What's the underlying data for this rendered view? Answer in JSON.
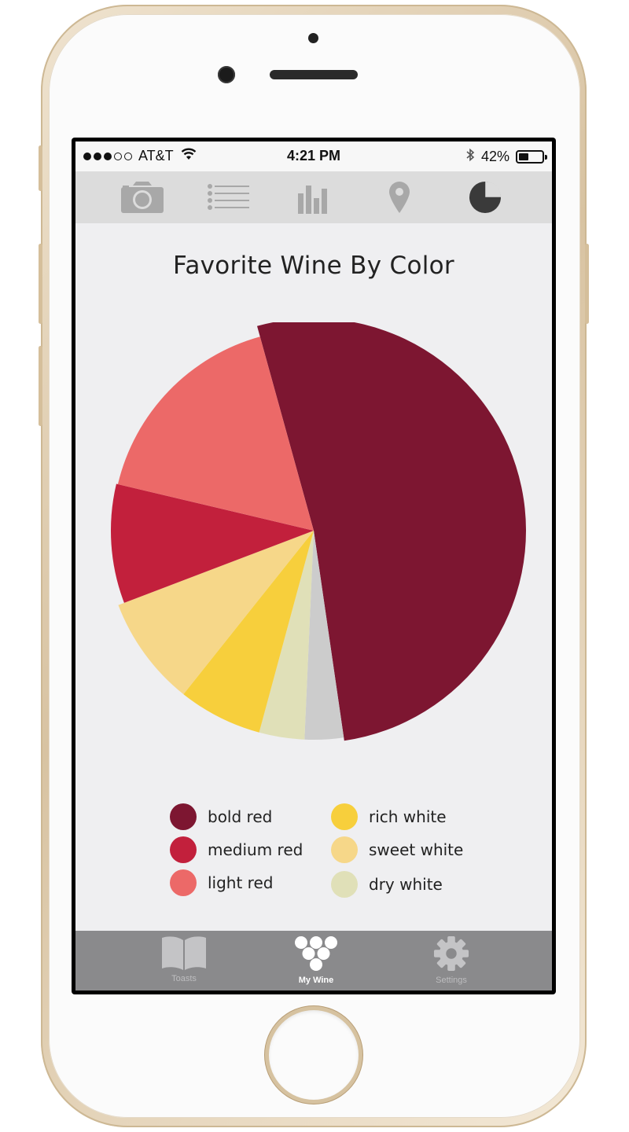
{
  "status_bar": {
    "carrier": "AT&T",
    "time": "4:21 PM",
    "battery": "42%",
    "battery_level": 0.42
  },
  "top_nav": {
    "icons": [
      "camera-icon",
      "list-icon",
      "bar-chart-icon",
      "location-pin-icon",
      "pie-chart-icon"
    ],
    "active": "pie-chart-icon"
  },
  "chart_title": "Favorite Wine By Color",
  "chart_data": {
    "type": "pie",
    "title": "Favorite Wine By Color",
    "slices": [
      {
        "label": "bold red",
        "value": 52,
        "color": "#7d1631"
      },
      {
        "label": "",
        "value": 3,
        "color": "#cccccc"
      },
      {
        "label": "dry white",
        "value": 3.5,
        "color": "#e0e0b8"
      },
      {
        "label": "rich white",
        "value": 6.5,
        "color": "#f7cf3c"
      },
      {
        "label": "sweet white",
        "value": 8.5,
        "color": "#f6d789"
      },
      {
        "label": "medium red",
        "value": 9.5,
        "color": "#c2203c"
      },
      {
        "label": "light red",
        "value": 17,
        "color": "#ec6968"
      }
    ],
    "legend_placement": "bottom"
  },
  "legend": [
    {
      "label": "bold red",
      "color": "#7d1631"
    },
    {
      "label": "medium red",
      "color": "#c2203c"
    },
    {
      "label": "light red",
      "color": "#ec6968"
    },
    {
      "label": "rich white",
      "color": "#f7cf3c"
    },
    {
      "label": "sweet white",
      "color": "#f6d789"
    },
    {
      "label": "dry white",
      "color": "#e0e0b8"
    }
  ],
  "tab_bar": {
    "tabs": [
      {
        "label": "Toasts",
        "icon": "book-icon"
      },
      {
        "label": "My Wine",
        "icon": "grapes-icon"
      },
      {
        "label": "Settings",
        "icon": "gear-icon"
      }
    ],
    "active": "My Wine"
  }
}
